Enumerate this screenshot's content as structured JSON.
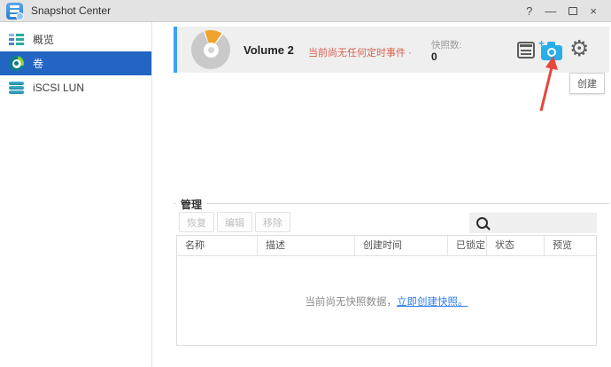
{
  "window": {
    "title": "Snapshot Center",
    "controls": {
      "help": "?",
      "minimize": "—",
      "close": "×"
    }
  },
  "sidebar": {
    "items": [
      {
        "label": "概览",
        "icon": "overview-list-icon",
        "selected": false
      },
      {
        "label": "卷",
        "icon": "volume-donut-icon",
        "selected": true
      },
      {
        "label": "iSCSI LUN",
        "icon": "iscsi-lun-disks-icon",
        "selected": false
      }
    ]
  },
  "volume_panel": {
    "name": "Volume 2",
    "schedule_status": "当前尚无任何定时事件 ·",
    "snapshot_count_label": "快照数:",
    "snapshot_count": "0",
    "buttons": [
      {
        "name": "schedule-calendar-icon"
      },
      {
        "name": "take-snapshot-camera-icon",
        "highlighted": true
      },
      {
        "name": "settings-gear-icon"
      }
    ],
    "tooltip": "创建"
  },
  "management": {
    "legend": "管理",
    "buttons": [
      {
        "label": "恢复",
        "enabled": false
      },
      {
        "label": "编辑",
        "enabled": false
      },
      {
        "label": "移除",
        "enabled": false
      }
    ],
    "search": {
      "value": "",
      "placeholder": ""
    },
    "table": {
      "columns": [
        "名称",
        "描述",
        "创建时间",
        "已锁定",
        "状态",
        "预览"
      ],
      "rows": [],
      "empty_text": "当前尚无快照数据，",
      "empty_link": "立即创建快照。"
    }
  },
  "icons": {
    "gear": "⚙",
    "camera_plus": "+"
  },
  "colors": {
    "sidebar_selected": "#2365c2",
    "panel_accent": "#3da1f5",
    "panel_background": "#efefef",
    "camera_blue": "#29aee8",
    "status_red": "#d9604e",
    "link_blue": "#2d7ff0",
    "annotation_red": "#e8453c",
    "volume_pie_orange": "#f0a32f"
  }
}
